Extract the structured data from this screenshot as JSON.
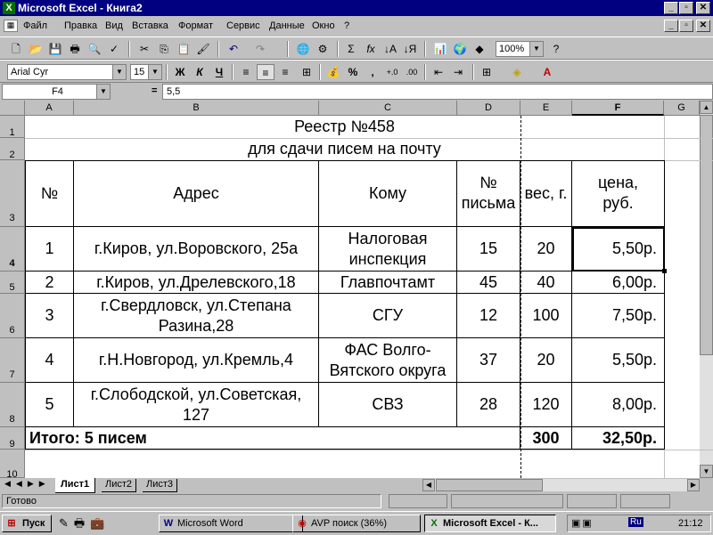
{
  "window": {
    "title": "Microsoft Excel - Книга2"
  },
  "menu": [
    "Файл",
    "Правка",
    "Вид",
    "Вставка",
    "Формат",
    "Сервис",
    "Данные",
    "Окно",
    "?"
  ],
  "format_bar": {
    "font": "Arial Cyr",
    "size": "15",
    "zoom": "100%"
  },
  "formula_bar": {
    "name_box": "F4",
    "equals": "=",
    "value": "5,5"
  },
  "columns": [
    "A",
    "B",
    "C",
    "D",
    "E",
    "F",
    "G"
  ],
  "rows": [
    "1",
    "2",
    "3",
    "4",
    "5",
    "6",
    "7",
    "8",
    "9",
    "10"
  ],
  "sheet": {
    "title1": "Реестр №458",
    "title2": "для сдачи писем на почту",
    "headers": [
      "№",
      "Адрес",
      "Кому",
      "№ письма",
      "вес, г.",
      "цена, руб."
    ],
    "data": [
      [
        "1",
        "г.Киров, ул.Воровского, 25а",
        "Налоговая инспекция",
        "15",
        "20",
        "5,50р."
      ],
      [
        "2",
        "г.Киров, ул.Дрелевского,18",
        "Главпочтамт",
        "45",
        "40",
        "6,00р."
      ],
      [
        "3",
        "г.Свердловск, ул.Степана Разина,28",
        "СГУ",
        "12",
        "100",
        "7,50р."
      ],
      [
        "4",
        "г.Н.Новгород, ул.Кремль,4",
        "ФАС Волго-Вятского округа",
        "37",
        "20",
        "5,50р."
      ],
      [
        "5",
        "г.Слободской, ул.Советская, 127",
        "СВЗ",
        "28",
        "120",
        "8,00р."
      ]
    ],
    "total": {
      "label": "Итого: 5 писем",
      "weight": "300",
      "price": "32,50р."
    }
  },
  "tabs": [
    "Лист1",
    "Лист2",
    "Лист3"
  ],
  "status": {
    "text": "Готово"
  },
  "taskbar": {
    "start": "Пуск",
    "tasks": [
      "Microsoft Word",
      "AVP поиск (36%)",
      "Microsoft Excel - К..."
    ],
    "tray_lang": "Ru",
    "clock": "21:12"
  },
  "colors": {
    "titlebar": "#000080",
    "face": "#c0c0c0",
    "grid": "#c0c0c0"
  }
}
